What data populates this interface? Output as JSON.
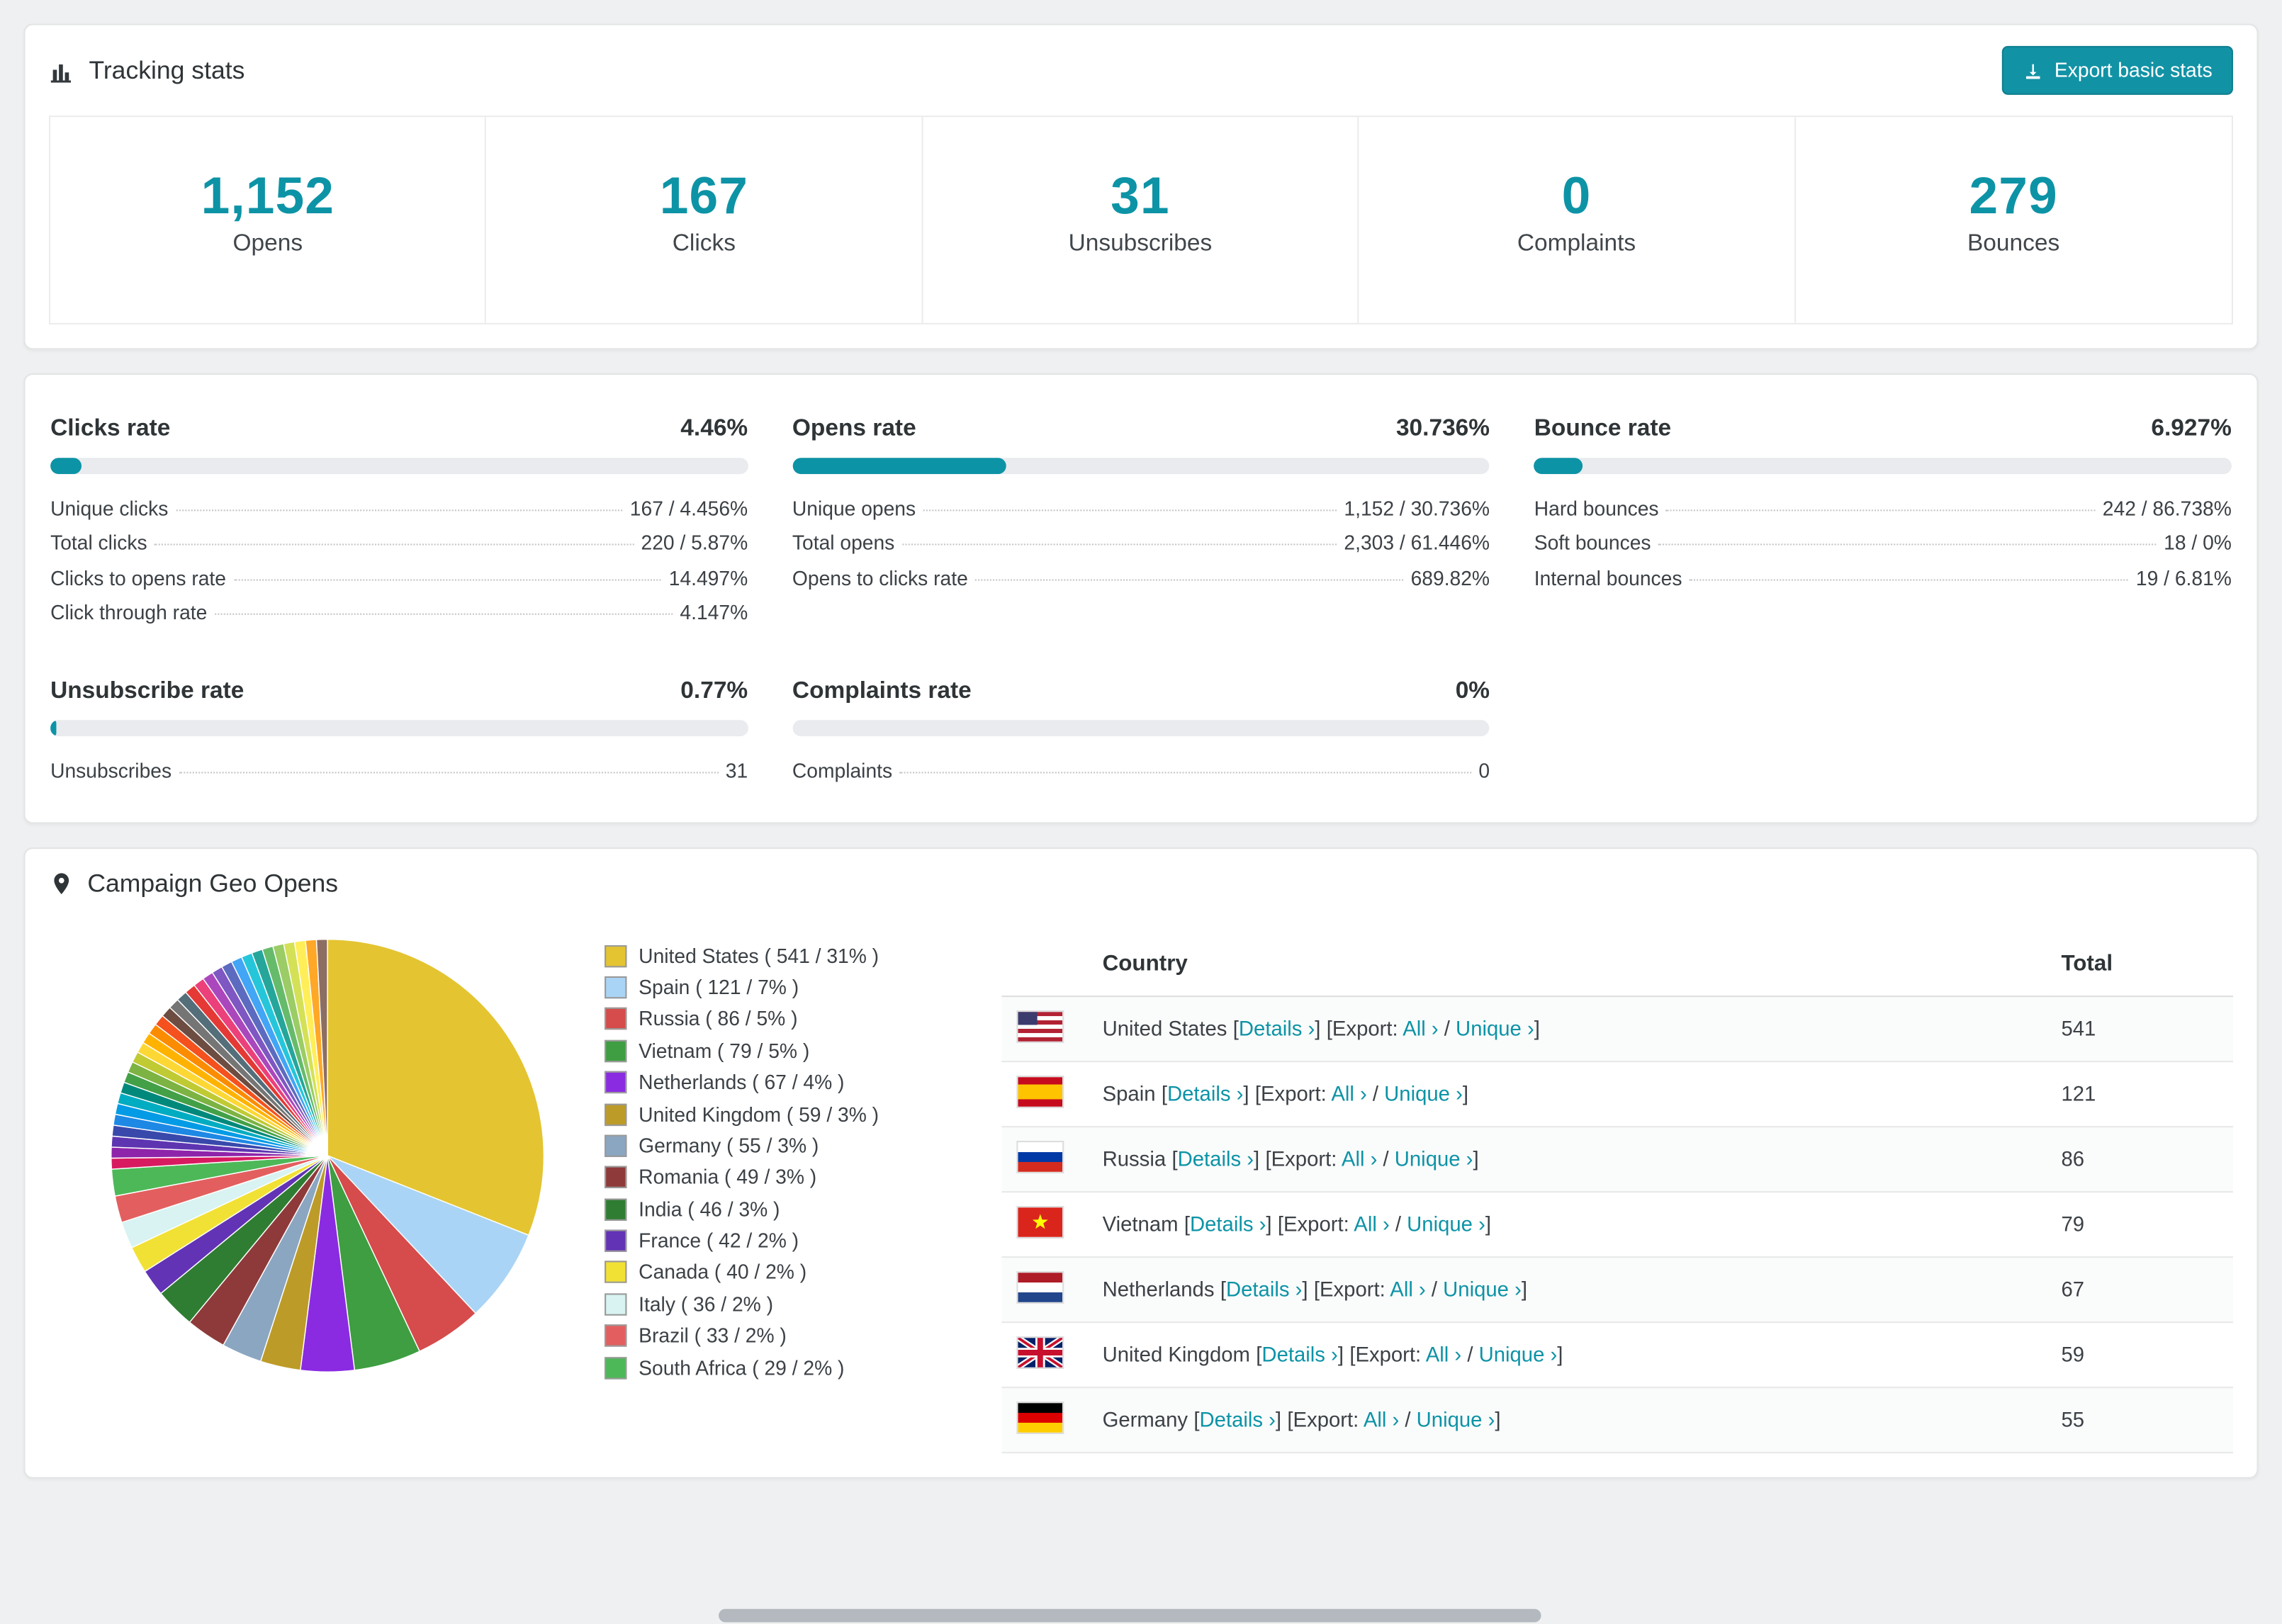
{
  "page": {
    "background": "#eef0f1",
    "accent": "#0d93a6"
  },
  "tracking": {
    "title": "Tracking stats",
    "export_label": "Export basic stats",
    "stats": [
      {
        "value": "1,152",
        "label": "Opens"
      },
      {
        "value": "167",
        "label": "Clicks"
      },
      {
        "value": "31",
        "label": "Unsubscribes"
      },
      {
        "value": "0",
        "label": "Complaints"
      },
      {
        "value": "279",
        "label": "Bounces"
      }
    ]
  },
  "rates": {
    "clicks": {
      "title": "Clicks rate",
      "value": "4.46%",
      "pct": 4.46,
      "rows": [
        {
          "label": "Unique clicks",
          "value": "167 / 4.456%"
        },
        {
          "label": "Total clicks",
          "value": "220 / 5.87%"
        },
        {
          "label": "Clicks to opens rate",
          "value": "14.497%"
        },
        {
          "label": "Click through rate",
          "value": "4.147%"
        }
      ]
    },
    "opens": {
      "title": "Opens rate",
      "value": "30.736%",
      "pct": 30.736,
      "rows": [
        {
          "label": "Unique opens",
          "value": "1,152 / 30.736%"
        },
        {
          "label": "Total opens",
          "value": "2,303 / 61.446%"
        },
        {
          "label": "Opens to clicks rate",
          "value": "689.82%"
        }
      ]
    },
    "bounce": {
      "title": "Bounce rate",
      "value": "6.927%",
      "pct": 6.927,
      "rows": [
        {
          "label": "Hard bounces",
          "value": "242 / 86.738%"
        },
        {
          "label": "Soft bounces",
          "value": "18 / 0%"
        },
        {
          "label": "Internal bounces",
          "value": "19 / 6.81%"
        }
      ]
    },
    "unsubscribe": {
      "title": "Unsubscribe rate",
      "value": "0.77%",
      "pct": 0.77,
      "rows": [
        {
          "label": "Unsubscribes",
          "value": "31"
        }
      ]
    },
    "complaints": {
      "title": "Complaints rate",
      "value": "0%",
      "pct": 0,
      "rows": [
        {
          "label": "Complaints",
          "value": "0"
        }
      ]
    }
  },
  "geo": {
    "title": "Campaign Geo Opens",
    "table": {
      "header": {
        "country": "Country",
        "total": "Total"
      },
      "links": {
        "details": "Details",
        "export": "Export:",
        "all": "All",
        "unique": "Unique",
        "arrow": "›"
      }
    },
    "countries": [
      {
        "code": "us",
        "name": "United States",
        "total": "541",
        "flag": {
          "stripes": [
            "#b22234",
            "#ffffff",
            "#b22234",
            "#ffffff",
            "#b22234",
            "#ffffff",
            "#b22234"
          ],
          "canton": "#3c3b6e"
        }
      },
      {
        "code": "es",
        "name": "Spain",
        "total": "121",
        "flag": {
          "stripes": [
            "#c60b1e",
            "#ffc400",
            "#c60b1e"
          ],
          "weights": [
            1,
            2,
            1
          ]
        }
      },
      {
        "code": "ru",
        "name": "Russia",
        "total": "86",
        "flag": {
          "stripes": [
            "#ffffff",
            "#0039a6",
            "#d52b1e"
          ]
        }
      },
      {
        "code": "vn",
        "name": "Vietnam",
        "total": "79",
        "flag": {
          "solid": "#da251d",
          "star": "#ffff00"
        }
      },
      {
        "code": "nl",
        "name": "Netherlands",
        "total": "67",
        "flag": {
          "stripes": [
            "#ae1c28",
            "#ffffff",
            "#21468b"
          ]
        }
      },
      {
        "code": "gb",
        "name": "United Kingdom",
        "total": "59",
        "flag": {
          "uk": true
        }
      },
      {
        "code": "de",
        "name": "Germany",
        "total": "55",
        "flag": {
          "stripes": [
            "#000000",
            "#dd0000",
            "#ffce00"
          ]
        }
      }
    ]
  },
  "chart_data": {
    "type": "pie",
    "title": "Campaign Geo Opens",
    "legend_position": "right",
    "series": [
      {
        "label": "United States",
        "value": 541,
        "pct": 31,
        "color": "#e4c431",
        "legend": "United States ( 541 / 31% )"
      },
      {
        "label": "Spain",
        "value": 121,
        "pct": 7,
        "color": "#aad4f5",
        "legend": "Spain ( 121 / 7% )"
      },
      {
        "label": "Russia",
        "value": 86,
        "pct": 5,
        "color": "#d64b4b",
        "legend": "Russia ( 86 / 5% )"
      },
      {
        "label": "Vietnam",
        "value": 79,
        "pct": 5,
        "color": "#3e9e41",
        "legend": "Vietnam ( 79 / 5% )"
      },
      {
        "label": "Netherlands",
        "value": 67,
        "pct": 4,
        "color": "#8a2be2",
        "legend": "Netherlands ( 67 / 4% )"
      },
      {
        "label": "United Kingdom",
        "value": 59,
        "pct": 3,
        "color": "#bd9b28",
        "legend": "United Kingdom ( 59 / 3% )"
      },
      {
        "label": "Germany",
        "value": 55,
        "pct": 3,
        "color": "#8ba6c1",
        "legend": "Germany ( 55 / 3% )"
      },
      {
        "label": "Romania",
        "value": 49,
        "pct": 3,
        "color": "#8f3a3a",
        "legend": "Romania ( 49 / 3% )"
      },
      {
        "label": "India",
        "value": 46,
        "pct": 3,
        "color": "#2f7d32",
        "legend": "India ( 46 / 3% )"
      },
      {
        "label": "France",
        "value": 42,
        "pct": 2,
        "color": "#6233b5",
        "legend": "France ( 42 / 2% )"
      },
      {
        "label": "Canada",
        "value": 40,
        "pct": 2,
        "color": "#f2e135",
        "legend": "Canada ( 40 / 2% )"
      },
      {
        "label": "Italy",
        "value": 36,
        "pct": 2,
        "color": "#d8f3f1",
        "legend": "Italy ( 36 / 2% )"
      },
      {
        "label": "Brazil",
        "value": 33,
        "pct": 2,
        "color": "#e35f5f",
        "legend": "Brazil ( 33 / 2% )"
      },
      {
        "label": "South Africa",
        "value": 29,
        "pct": 2,
        "color": "#4db858",
        "legend": "South Africa ( 29 / 2% )"
      }
    ],
    "others": {
      "pct": 26,
      "colors": [
        "#d81b60",
        "#8e24aa",
        "#5e35b1",
        "#3949ab",
        "#1e88e5",
        "#039be5",
        "#00acc1",
        "#00897b",
        "#43a047",
        "#7cb342",
        "#c0ca33",
        "#fdd835",
        "#ffb300",
        "#fb8c00",
        "#f4511e",
        "#6d4c41",
        "#757575",
        "#546e7a",
        "#e53935",
        "#ec407a",
        "#ab47bc",
        "#7e57c2",
        "#5c6bc0",
        "#42a5f5",
        "#26c6da",
        "#26a69a",
        "#66bb6a",
        "#9ccc65",
        "#d4e157",
        "#ffee58",
        "#ffa726",
        "#8d6e63"
      ]
    }
  }
}
